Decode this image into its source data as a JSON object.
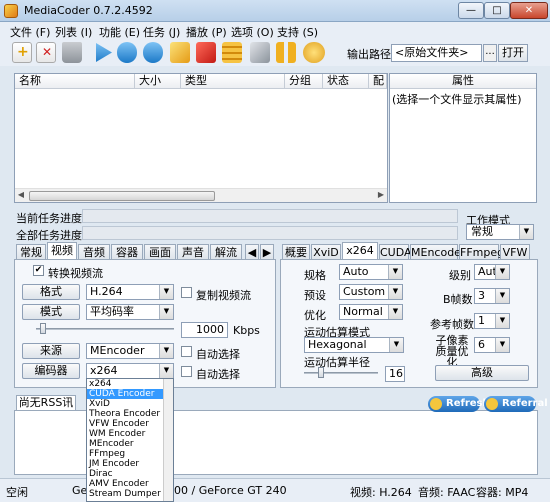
{
  "window": {
    "title": "MediaCoder 0.7.2.4592",
    "minimize_glyph": "—",
    "maximize_glyph": "□",
    "close_glyph": "✕"
  },
  "menu": [
    "文件 (F)",
    "列表 (I)",
    "功能 (E)",
    "任务 (J)",
    "播放 (P)",
    "选项 (O)",
    "支持 (S)"
  ],
  "toolbar": {
    "icons": [
      "add-file-icon",
      "remove-file-icon",
      "trash-icon",
      "play-icon",
      "next-icon",
      "stop-icon",
      "wizard-icon",
      "puzzle-icon",
      "list-icon",
      "wrench-icon",
      "pause-icon",
      "start-icon"
    ],
    "output_label": "输出路径",
    "output_value": "<原始文件夹>",
    "browse_label": "...",
    "open_label": "打开"
  },
  "filelist": {
    "columns": [
      "名称",
      "大小",
      "类型",
      "分组",
      "状态",
      "配"
    ]
  },
  "properties": {
    "header": "属性",
    "placeholder": "(选择一个文件显示其属性)"
  },
  "progress": {
    "current_label": "当前任务进度:",
    "total_label": "全部任务进度:"
  },
  "workmode": {
    "label": "工作模式",
    "value": "常规"
  },
  "left_tabs": [
    "常规",
    "视频",
    "音频",
    "容器",
    "画面",
    "声音",
    "解流"
  ],
  "right_tabs": [
    "概要",
    "XviD",
    "x264",
    "CUDA",
    "MEncoder",
    "FFmpeg",
    "VFW"
  ],
  "video": {
    "enable_label": "转换视频流",
    "format_btn": "格式",
    "format_value": "H.264",
    "copy_label": "复制视频流",
    "mode_btn": "模式",
    "mode_value": "平均码率",
    "bitrate_value": "1000",
    "bitrate_unit": "Kbps",
    "source_btn": "来源",
    "source_value": "MEncoder",
    "encoder_btn": "编码器",
    "encoder_value": "x264",
    "auto_select": "自动选择"
  },
  "x264": {
    "profile_label": "规格",
    "profile_value": "Auto",
    "preset_label": "预设",
    "preset_value": "Custom",
    "optimize_label": "优化",
    "optimize_value": "Normal",
    "me_label": "运动估算模式",
    "me_value": "Hexagonal",
    "merange_label": "运动估算半径",
    "merange_value": "16",
    "level_label": "级别",
    "level_value": "Auto",
    "bframes_label": "B帧数",
    "bframes_value": "3",
    "ref_label": "参考帧数",
    "ref_value": "1",
    "subme_label": "子像素质量优化",
    "subme_value": "6",
    "advanced_btn": "高级"
  },
  "encoder_options": [
    "x264",
    "CUDA Encoder",
    "XviD",
    "Theora Encoder",
    "VFW Encoder",
    "WM Encoder",
    "MEncoder",
    "FFmpeg",
    "JM Encoder",
    "Dirac",
    "AMV Encoder",
    "Stream Dumper"
  ],
  "rss": {
    "tab": "尚无RSS讯息",
    "refresh": "Refresh",
    "referral": "Referral"
  },
  "status": {
    "state": "空闲",
    "gpu_prefix": "Ge",
    "gpu": "00  / GeForce GT 240",
    "video": "视频: H.264",
    "audio": "音频: FAAC",
    "container": "容器: MP4"
  }
}
